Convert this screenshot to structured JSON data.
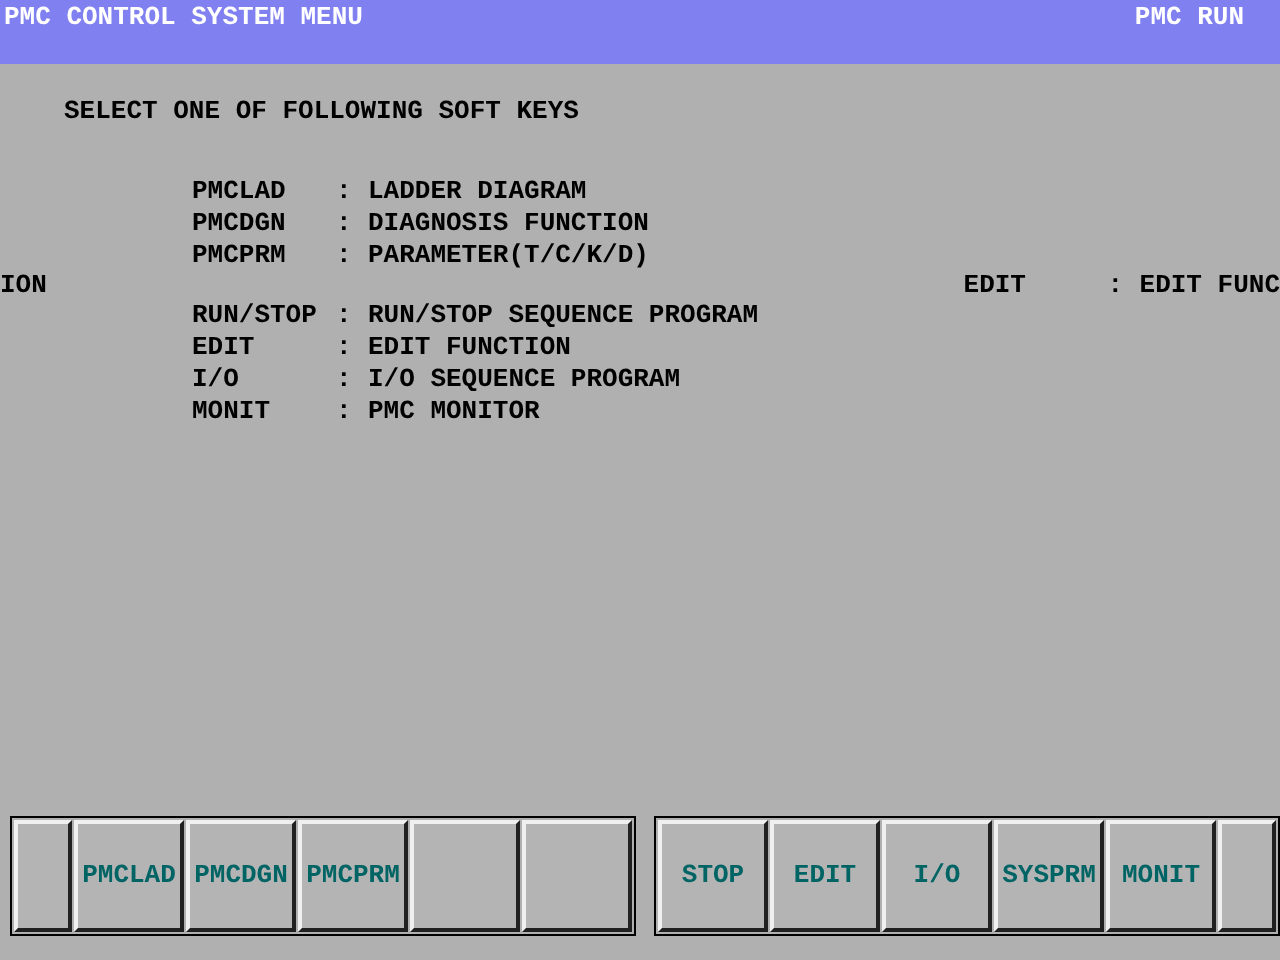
{
  "title_bar": {
    "title": "PMC CONTROL SYSTEM MENU",
    "status": "PMC RUN"
  },
  "prompt": "SELECT ONE OF FOLLOWING SOFT KEYS",
  "menu": [
    {
      "key": "PMCLAD",
      "sep": ":",
      "desc": "LADDER DIAGRAM"
    },
    {
      "key": "PMCDGN",
      "sep": ":",
      "desc": "DIAGNOSIS FUNCTION"
    },
    {
      "key": "PMCPRM",
      "sep": ":",
      "desc": "PARAMETER(T/C/K/D)"
    },
    {
      "key": "RUN/STOP",
      "sep": ":",
      "desc": "RUN/STOP SEQUENCE PROGRAM"
    },
    {
      "key": "EDIT",
      "sep": ":",
      "desc": "EDIT FUNCTION"
    },
    {
      "key": "I/O",
      "sep": ":",
      "desc": "I/O SEQUENCE PROGRAM"
    },
    {
      "key": "MONIT",
      "sep": ":",
      "desc": "PMC MONITOR"
    }
  ],
  "ghost_line": {
    "left": "ION",
    "right_key": "EDIT",
    "right_sep": ":",
    "right_desc": "EDIT FUNC"
  },
  "softkeys_left": [
    {
      "kind": "blank"
    },
    {
      "kind": "key",
      "label": "PMCLAD"
    },
    {
      "kind": "key",
      "label": "PMCDGN"
    },
    {
      "kind": "key",
      "label": "PMCPRM"
    },
    {
      "kind": "key"
    },
    {
      "kind": "key"
    }
  ],
  "softkeys_right": [
    {
      "kind": "key",
      "label": "STOP"
    },
    {
      "kind": "key",
      "label": "EDIT"
    },
    {
      "kind": "key",
      "label": "I/O"
    },
    {
      "kind": "key",
      "label": "SYSPRM"
    },
    {
      "kind": "key",
      "label": "MONIT"
    },
    {
      "kind": "blank"
    }
  ]
}
